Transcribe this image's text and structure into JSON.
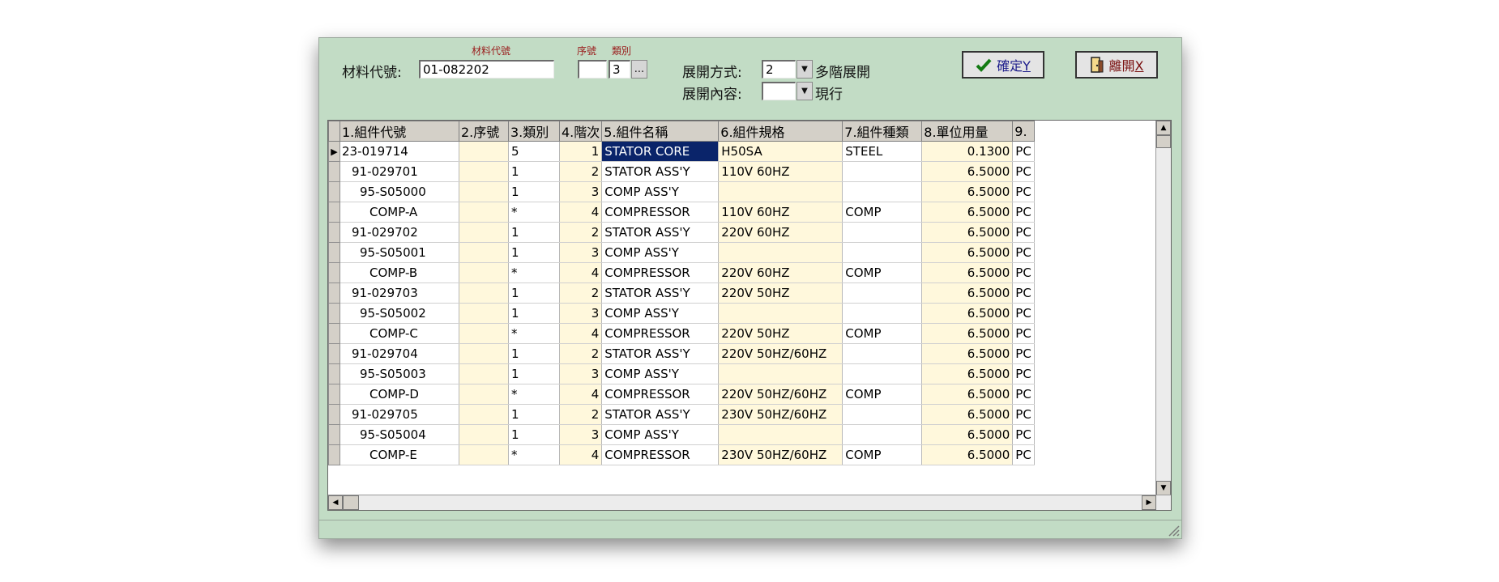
{
  "header": {
    "small_labels": {
      "material_code": "材料代號",
      "seq": "序號",
      "category": "類別"
    },
    "material_label": "材料代號:",
    "material_value": "01-082202",
    "seq_value": "",
    "category_value": "3",
    "browse_label": "...",
    "expand_method_label": "展開方式:",
    "expand_method_value": "2",
    "expand_method_text": "多階展開",
    "expand_content_label": "展開內容:",
    "expand_content_value": "",
    "expand_content_text": "現行"
  },
  "buttons": {
    "confirm_label": "確定",
    "confirm_key": "Y",
    "leave_label": "離開",
    "leave_key": "X"
  },
  "grid": {
    "columns": [
      "1.組件代號",
      "2.序號",
      "3.類別",
      "4.階次",
      "5.組件名稱",
      "6.組件規格",
      "7.組件種類",
      "8.單位用量",
      "9."
    ],
    "rows": [
      [
        "23-019714",
        "",
        "5",
        "1",
        "STATOR CORE",
        "H50SA",
        "STEEL",
        "0.1300",
        "PC"
      ],
      [
        "91-029701",
        "",
        "1",
        "2",
        "STATOR ASS'Y",
        "110V 60HZ",
        "",
        "6.5000",
        "PC"
      ],
      [
        "95-S05000",
        "",
        "1",
        "3",
        "COMP ASS'Y",
        "",
        "",
        "6.5000",
        "PC"
      ],
      [
        "COMP-A",
        "",
        "*",
        "4",
        "COMPRESSOR",
        "110V 60HZ",
        "COMP",
        "6.5000",
        "PC"
      ],
      [
        "91-029702",
        "",
        "1",
        "2",
        "STATOR ASS'Y",
        "220V 60HZ",
        "",
        "6.5000",
        "PC"
      ],
      [
        "95-S05001",
        "",
        "1",
        "3",
        "COMP ASS'Y",
        "",
        "",
        "6.5000",
        "PC"
      ],
      [
        "COMP-B",
        "",
        "*",
        "4",
        "COMPRESSOR",
        "220V 60HZ",
        "COMP",
        "6.5000",
        "PC"
      ],
      [
        "91-029703",
        "",
        "1",
        "2",
        "STATOR ASS'Y",
        "220V 50HZ",
        "",
        "6.5000",
        "PC"
      ],
      [
        "95-S05002",
        "",
        "1",
        "3",
        "COMP ASS'Y",
        "",
        "",
        "6.5000",
        "PC"
      ],
      [
        "COMP-C",
        "",
        "*",
        "4",
        "COMPRESSOR",
        "220V 50HZ",
        "COMP",
        "6.5000",
        "PC"
      ],
      [
        "91-029704",
        "",
        "1",
        "2",
        "STATOR ASS'Y",
        "220V 50HZ/60HZ",
        "",
        "6.5000",
        "PC"
      ],
      [
        "95-S05003",
        "",
        "1",
        "3",
        "COMP ASS'Y",
        "",
        "",
        "6.5000",
        "PC"
      ],
      [
        "COMP-D",
        "",
        "*",
        "4",
        "COMPRESSOR",
        "220V 50HZ/60HZ",
        "COMP",
        "6.5000",
        "PC"
      ],
      [
        "91-029705",
        "",
        "1",
        "2",
        "STATOR ASS'Y",
        "230V 50HZ/60HZ",
        "",
        "6.5000",
        "PC"
      ],
      [
        "95-S05004",
        "",
        "1",
        "3",
        "COMP ASS'Y",
        "",
        "",
        "6.5000",
        "PC"
      ],
      [
        "COMP-E",
        "",
        "*",
        "4",
        "COMPRESSOR",
        "230V 50HZ/60HZ",
        "COMP",
        "6.5000",
        "PC"
      ]
    ]
  },
  "colors": {
    "window_bg": "#c2dcc5",
    "grid_yellow": "#fff8dc",
    "selection": "#0a246a"
  }
}
